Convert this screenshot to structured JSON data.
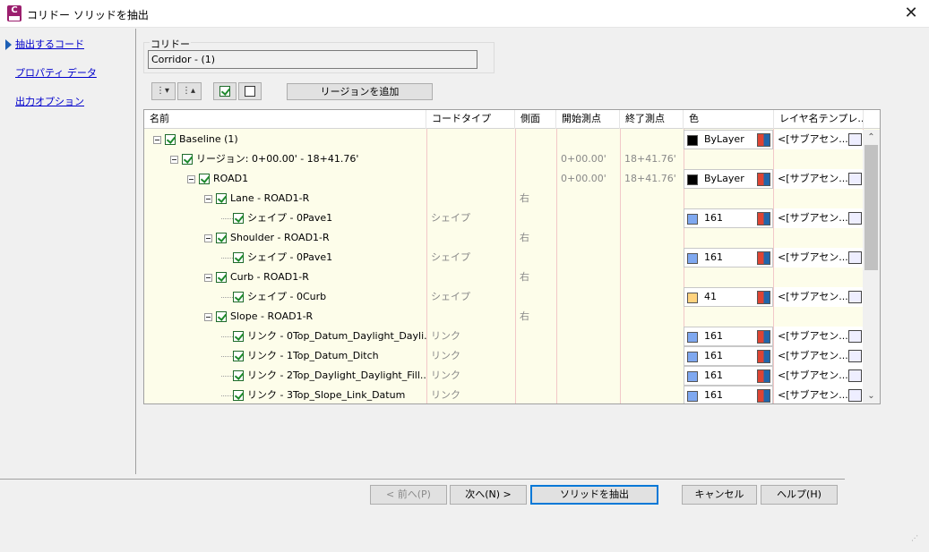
{
  "window": {
    "title": "コリドー ソリッドを抽出",
    "icon": "civil3d-app-icon",
    "icon_text": "C"
  },
  "nav": {
    "items": [
      {
        "label": "抽出するコード",
        "active": true
      },
      {
        "label": "プロパティ データ",
        "active": false
      },
      {
        "label": "出力オプション",
        "active": false
      }
    ]
  },
  "corridor": {
    "group_label": "コリドー",
    "value": "Corridor - (1)"
  },
  "toolbar": {
    "expand_all_icon": "expand-all-icon",
    "collapse_all_icon": "collapse-all-icon",
    "check_all_icon": "check-all-icon",
    "uncheck_all_icon": "uncheck-all-icon",
    "add_region_label": "リージョンを追加"
  },
  "grid": {
    "headers": [
      "名前",
      "コードタイプ",
      "側面",
      "開始測点",
      "終了測点",
      "色",
      "レイヤ名テンプレ..."
    ],
    "rows": [
      {
        "level": 0,
        "expander": true,
        "checked": true,
        "name": "Baseline (1)",
        "type": "",
        "side": "",
        "start": "",
        "end": "",
        "color": "ByLayer",
        "swatch": "#000000",
        "layer": "<[サブアセン..."
      },
      {
        "level": 1,
        "expander": true,
        "checked": true,
        "name": "リージョン: 0+00.00' - 18+41.76'",
        "type": "",
        "side": "",
        "start": "0+00.00'",
        "end": "18+41.76'",
        "color": "",
        "swatch": "",
        "layer": ""
      },
      {
        "level": 2,
        "expander": true,
        "checked": true,
        "name": "ROAD1",
        "type": "",
        "side": "",
        "start": "0+00.00'",
        "end": "18+41.76'",
        "color": "ByLayer",
        "swatch": "#000000",
        "layer": "<[サブアセン..."
      },
      {
        "level": 3,
        "expander": true,
        "checked": true,
        "name": "Lane - ROAD1-R",
        "type": "",
        "side": "右",
        "start": "",
        "end": "",
        "color": "",
        "swatch": "",
        "layer": ""
      },
      {
        "level": 4,
        "expander": false,
        "checked": true,
        "name": "シェイプ - 0Pave1",
        "type": "シェイプ",
        "side": "",
        "start": "",
        "end": "",
        "color": "161",
        "swatch": "#7fa8f0",
        "layer": "<[サブアセン..."
      },
      {
        "level": 3,
        "expander": true,
        "checked": true,
        "name": "Shoulder - ROAD1-R",
        "type": "",
        "side": "右",
        "start": "",
        "end": "",
        "color": "",
        "swatch": "",
        "layer": ""
      },
      {
        "level": 4,
        "expander": false,
        "checked": true,
        "name": "シェイプ - 0Pave1",
        "type": "シェイプ",
        "side": "",
        "start": "",
        "end": "",
        "color": "161",
        "swatch": "#7fa8f0",
        "layer": "<[サブアセン..."
      },
      {
        "level": 3,
        "expander": true,
        "checked": true,
        "name": "Curb - ROAD1-R",
        "type": "",
        "side": "右",
        "start": "",
        "end": "",
        "color": "",
        "swatch": "",
        "layer": ""
      },
      {
        "level": 4,
        "expander": false,
        "checked": true,
        "name": "シェイプ - 0Curb",
        "type": "シェイプ",
        "side": "",
        "start": "",
        "end": "",
        "color": "41",
        "swatch": "#ffd37f",
        "layer": "<[サブアセン..."
      },
      {
        "level": 3,
        "expander": true,
        "checked": true,
        "name": "Slope - ROAD1-R",
        "type": "",
        "side": "右",
        "start": "",
        "end": "",
        "color": "",
        "swatch": "",
        "layer": ""
      },
      {
        "level": 4,
        "expander": false,
        "checked": true,
        "name": "リンク - 0Top_Datum_Daylight_Dayli...",
        "type": "リンク",
        "side": "",
        "start": "",
        "end": "",
        "color": "161",
        "swatch": "#7fa8f0",
        "layer": "<[サブアセン..."
      },
      {
        "level": 4,
        "expander": false,
        "checked": true,
        "name": "リンク - 1Top_Datum_Ditch",
        "type": "リンク",
        "side": "",
        "start": "",
        "end": "",
        "color": "161",
        "swatch": "#7fa8f0",
        "layer": "<[サブアセン..."
      },
      {
        "level": 4,
        "expander": false,
        "checked": true,
        "name": "リンク - 2Top_Daylight_Daylight_Fill...",
        "type": "リンク",
        "side": "",
        "start": "",
        "end": "",
        "color": "161",
        "swatch": "#7fa8f0",
        "layer": "<[サブアセン..."
      },
      {
        "level": 4,
        "expander": false,
        "checked": true,
        "name": "リンク - 3Top_Slope_Link_Datum",
        "type": "リンク",
        "side": "",
        "start": "",
        "end": "",
        "color": "161",
        "swatch": "#7fa8f0",
        "layer": "<[サブアセン..."
      }
    ]
  },
  "buttons": {
    "back": "< 前へ(P)",
    "next": "次へ(N) >",
    "extract": "ソリッドを抽出",
    "cancel": "キャンセル",
    "help": "ヘルプ(H)"
  }
}
